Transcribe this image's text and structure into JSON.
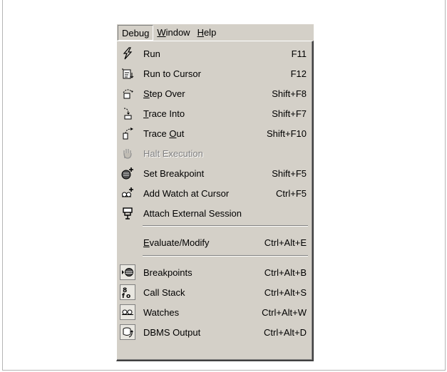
{
  "menubar": {
    "debug": "Debug",
    "window": "Window",
    "help": "Help"
  },
  "menu": {
    "items": [
      {
        "label": "Run",
        "shortcut": "F11",
        "icon": "run-icon"
      },
      {
        "label": "Run to Cursor",
        "shortcut": "F12",
        "icon": "run-to-cursor-icon"
      },
      {
        "label": "Step Over",
        "shortcut": "Shift+F8",
        "icon": "step-over-icon"
      },
      {
        "label": "Trace Into",
        "shortcut": "Shift+F7",
        "icon": "trace-into-icon"
      },
      {
        "label": "Trace Out",
        "shortcut": "Shift+F10",
        "icon": "trace-out-icon"
      },
      {
        "label": "Halt Execution",
        "shortcut": "",
        "icon": "halt-hand-icon",
        "disabled": true
      },
      {
        "label": "Set Breakpoint",
        "shortcut": "Shift+F5",
        "icon": "breakpoint-icon"
      },
      {
        "label": "Add Watch at Cursor",
        "shortcut": "Ctrl+F5",
        "icon": "add-watch-icon"
      },
      {
        "label": "Attach External Session",
        "shortcut": "",
        "icon": "attach-session-icon"
      },
      {
        "label": "Evaluate/Modify",
        "shortcut": "Ctrl+Alt+E",
        "icon": ""
      },
      {
        "label": "Breakpoints",
        "shortcut": "Ctrl+Alt+B",
        "icon": "breakpoints-window-icon"
      },
      {
        "label": "Call Stack",
        "shortcut": "Ctrl+Alt+S",
        "icon": "call-stack-icon"
      },
      {
        "label": "Watches",
        "shortcut": "Ctrl+Alt+W",
        "icon": "watches-icon"
      },
      {
        "label": "DBMS Output",
        "shortcut": "Ctrl+Alt+D",
        "icon": "dbms-output-icon"
      }
    ]
  }
}
